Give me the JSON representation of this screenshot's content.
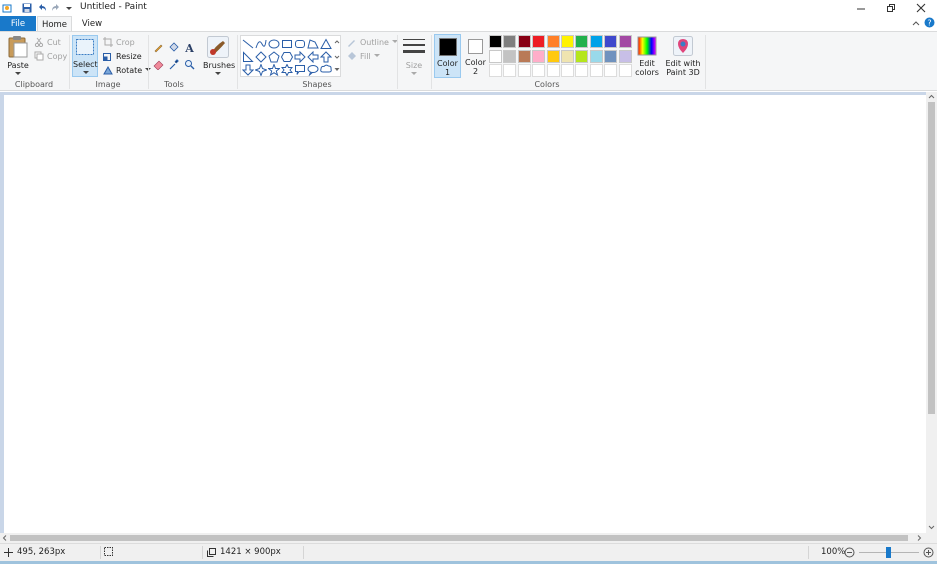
{
  "window": {
    "title": "Untitled - Paint"
  },
  "tabs": {
    "file": "File",
    "home": "Home",
    "view": "View"
  },
  "clipboard": {
    "paste": "Paste",
    "cut": "Cut",
    "copy": "Copy",
    "group": "Clipboard"
  },
  "image": {
    "select": "Select",
    "crop": "Crop",
    "resize": "Resize",
    "rotate": "Rotate",
    "group": "Image"
  },
  "tools": {
    "group": "Tools"
  },
  "brushes": {
    "label": "Brushes"
  },
  "shapes": {
    "group": "Shapes",
    "outline": "Outline",
    "fill": "Fill"
  },
  "size": {
    "label": "Size"
  },
  "colors": {
    "color1_label": "Color",
    "color1_num": "1",
    "color2_label": "Color",
    "color2_num": "2",
    "edit_colors_1": "Edit",
    "edit_colors_2": "colors",
    "paint3d_1": "Edit with",
    "paint3d_2": "Paint 3D",
    "group": "Colors",
    "color1_value": "#000000",
    "color2_value": "#ffffff",
    "palette_row1": [
      "#000000",
      "#7f7f7f",
      "#880015",
      "#ed1c24",
      "#ff7f27",
      "#fff200",
      "#22b14c",
      "#00a2e8",
      "#3f48cc",
      "#a349a4"
    ],
    "palette_row2": [
      "#ffffff",
      "#c3c3c3",
      "#b97a57",
      "#ffaec9",
      "#ffc90e",
      "#efe4b0",
      "#b5e61d",
      "#99d9ea",
      "#7092be",
      "#c8bfe7"
    ]
  },
  "status": {
    "cursor_pos": "495, 263px",
    "canvas_size": "1421 × 900px",
    "zoom": "100%"
  }
}
